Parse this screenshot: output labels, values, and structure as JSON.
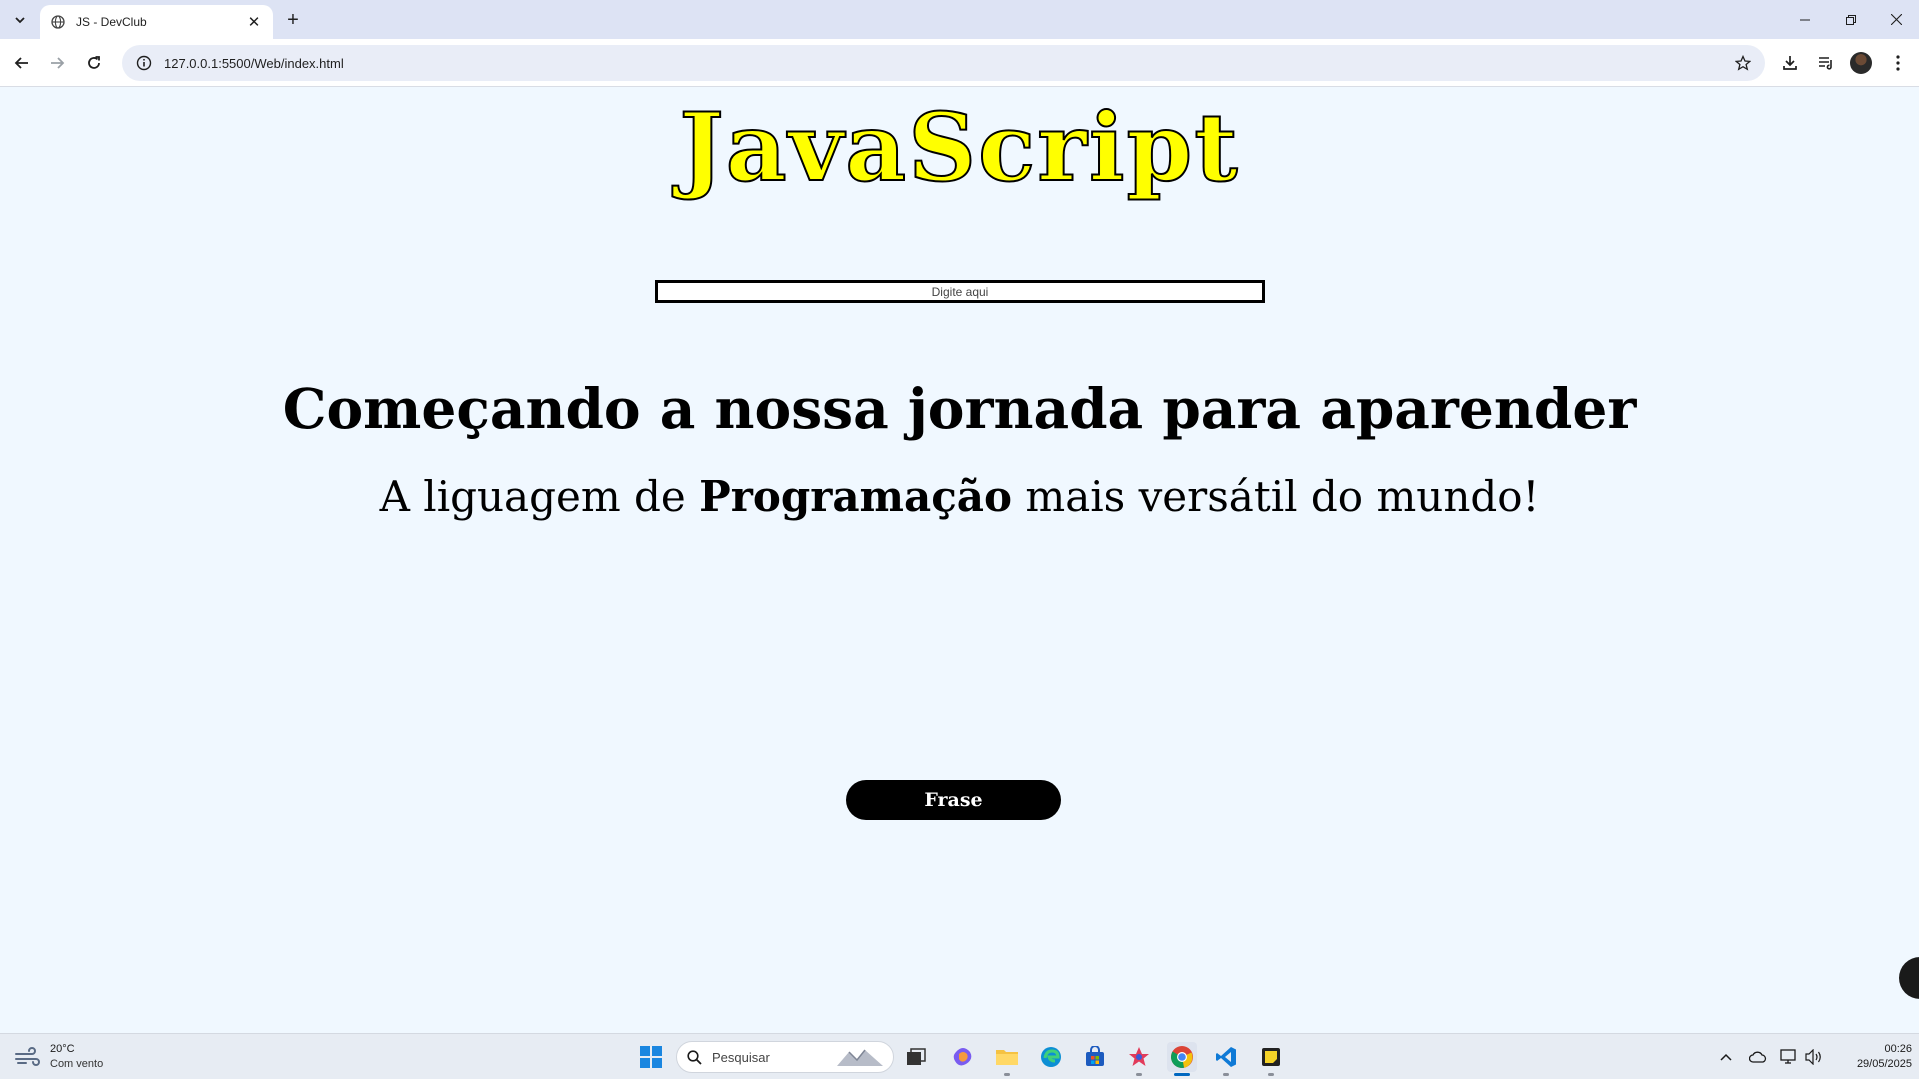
{
  "browser": {
    "tab_title": "JS - DevClub",
    "url": "127.0.0.1:5500/Web/index.html"
  },
  "page": {
    "title": "JavaScript",
    "input_placeholder": "Digite aqui",
    "headline": "Começando a nossa jornada para aparender",
    "subline_before": "A liguagem de ",
    "subline_bold": "Programação",
    "subline_after": " mais versátil do mundo!",
    "button_label": "Frase"
  },
  "taskbar": {
    "weather_temp": "20°C",
    "weather_condition": "Com vento",
    "search_placeholder": "Pesquisar",
    "time": "00:26",
    "date": "29/05/2025",
    "apps": [
      "windows-start-icon",
      "task-view-icon",
      "copilot-icon",
      "file-explorer-icon",
      "edge-icon",
      "store-icon",
      "app-icon",
      "chrome-icon",
      "vscode-icon",
      "sticky-notes-icon"
    ]
  },
  "colors": {
    "page_background": "#f0f8ff",
    "title_fill": "#ffff00",
    "button_background": "#000000",
    "button_text": "#ffffff"
  }
}
